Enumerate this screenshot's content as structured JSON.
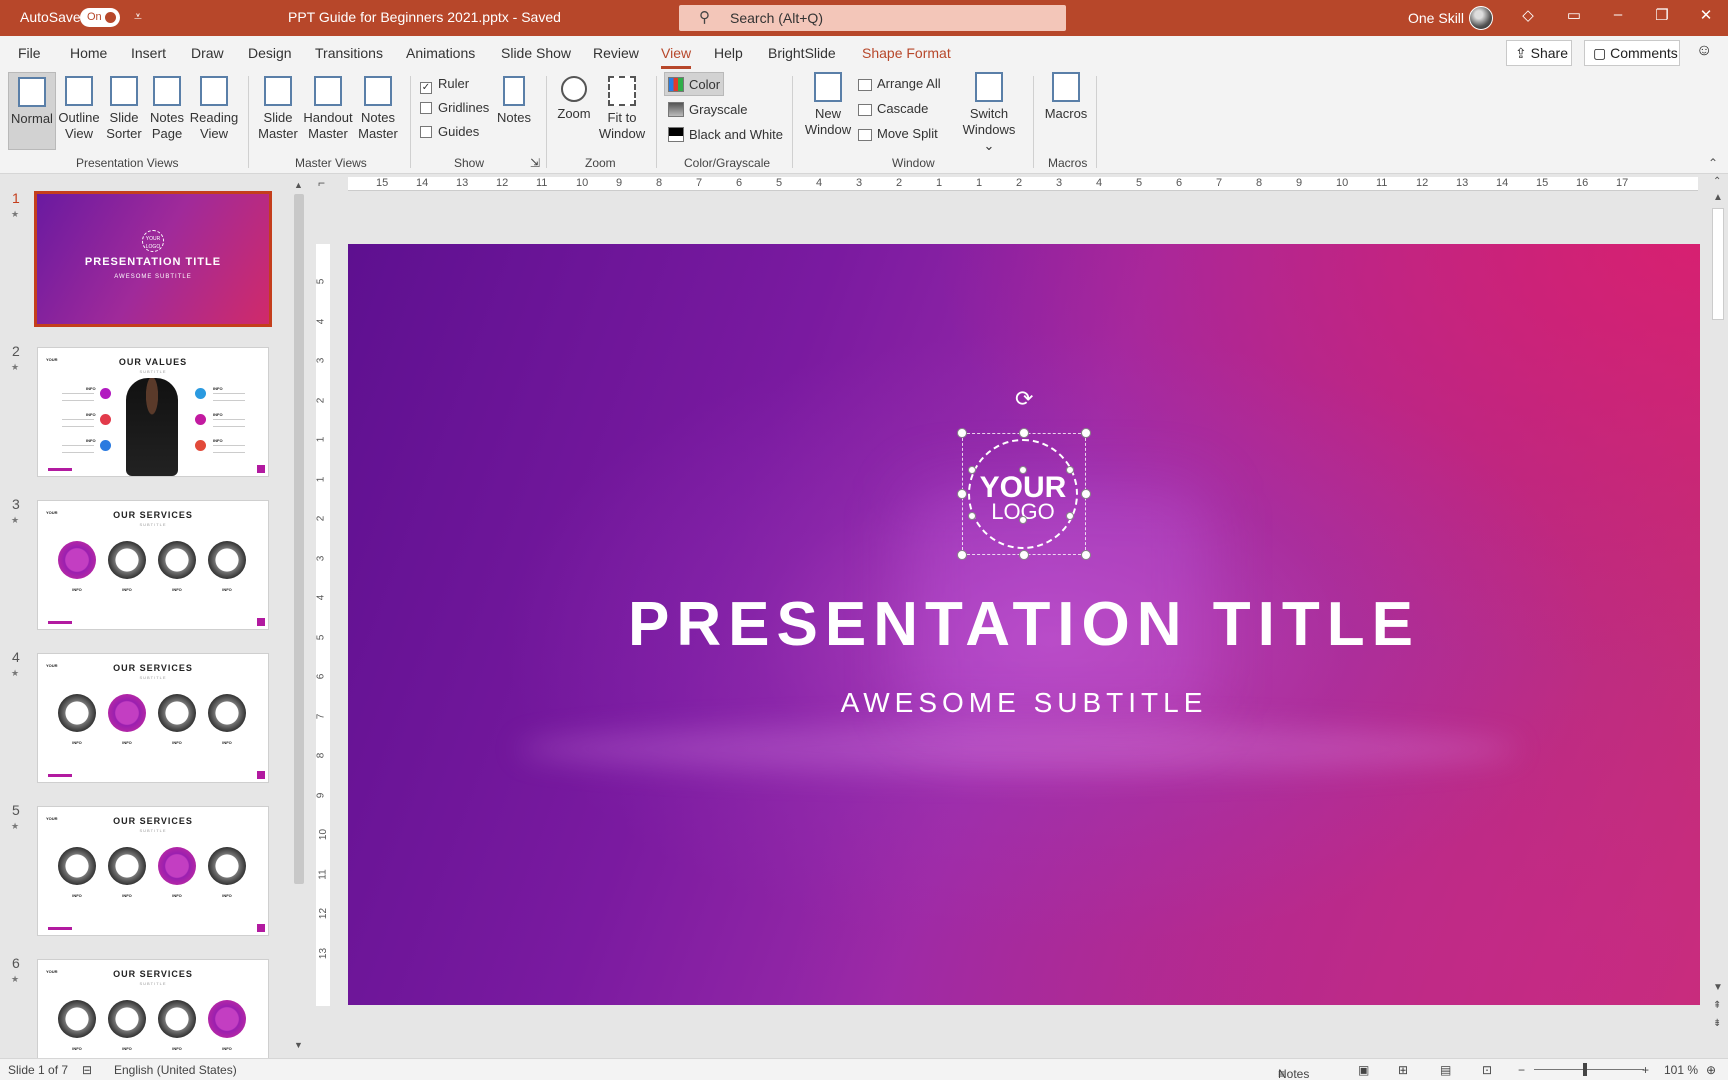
{
  "titlebar": {
    "autosave_label": "AutoSave",
    "toggle_state": "On",
    "doc_title": "PPT Guide for Beginners 2021.pptx  -  Saved",
    "search_placeholder": "Search (Alt+Q)",
    "user_name": "One Skill"
  },
  "tabs": [
    "File",
    "Home",
    "Insert",
    "Draw",
    "Design",
    "Transitions",
    "Animations",
    "Slide Show",
    "Review",
    "View",
    "Help",
    "BrightSlide",
    "Shape Format"
  ],
  "active_tab": "View",
  "share_label": "Share",
  "comments_label": "Comments",
  "ribbon": {
    "presentation_views": {
      "label": "Presentation Views",
      "items": [
        [
          "Normal",
          ""
        ],
        [
          "Outline",
          "View"
        ],
        [
          "Slide",
          "Sorter"
        ],
        [
          "Notes",
          "Page"
        ],
        [
          "Reading",
          "View"
        ]
      ]
    },
    "master_views": {
      "label": "Master Views",
      "items": [
        [
          "Slide",
          "Master"
        ],
        [
          "Handout",
          "Master"
        ],
        [
          "Notes",
          "Master"
        ]
      ]
    },
    "show": {
      "label": "Show",
      "ruler": "Ruler",
      "ruler_checked": true,
      "gridlines": "Gridlines",
      "guides": "Guides",
      "notes": "Notes"
    },
    "zoom": {
      "label": "Zoom",
      "zoom_btn": "Zoom",
      "fit": [
        "Fit to",
        "Window"
      ]
    },
    "color": {
      "label": "Color/Grayscale",
      "color": "Color",
      "grayscale": "Grayscale",
      "bw": "Black and White"
    },
    "window": {
      "label": "Window",
      "new_window": [
        "New",
        "Window"
      ],
      "arrange_all": "Arrange All",
      "cascade": "Cascade",
      "move_split": "Move Split",
      "switch_windows": [
        "Switch",
        "Windows"
      ]
    },
    "macros": {
      "label": "Macros",
      "macros_btn": "Macros"
    }
  },
  "thumbnails": {
    "numbers": [
      "1",
      "2",
      "3",
      "4",
      "5",
      "6"
    ],
    "slide1": {
      "logo": "YOUR LOGO",
      "title": "PRESENTATION TITLE",
      "subtitle": "AWESOME SUBTITLE"
    },
    "slide2": {
      "heading": "OUR VALUES",
      "sub": "SUBTITLE",
      "mini_logo": "YOUR",
      "info": "INFO"
    },
    "services": {
      "heading": "OUR SERVICES",
      "sub": "SUBTITLE",
      "mini_logo": "YOUR",
      "info": "INFO"
    }
  },
  "ruler": {
    "h": [
      "15",
      "14",
      "13",
      "12",
      "11",
      "10",
      "9",
      "8",
      "7",
      "6",
      "5",
      "4",
      "3",
      "2",
      "1",
      "1",
      "2",
      "3",
      "4",
      "5",
      "6",
      "7",
      "8",
      "9",
      "10",
      "11",
      "12",
      "13",
      "14",
      "15",
      "16",
      "17"
    ],
    "v": [
      "5",
      "4",
      "3",
      "2",
      "1",
      "1",
      "2",
      "3",
      "4",
      "5",
      "6",
      "7",
      "8",
      "9",
      "10",
      "11",
      "12",
      "13"
    ]
  },
  "slide": {
    "logo_top": "YOUR",
    "logo_bottom": "LOGO",
    "title": "PRESENTATION TITLE",
    "subtitle": "AWESOME SUBTITLE"
  },
  "status": {
    "slide_info": "Slide 1 of 7",
    "language": "English (United States)",
    "notes": "Notes",
    "zoom": "101 %"
  }
}
